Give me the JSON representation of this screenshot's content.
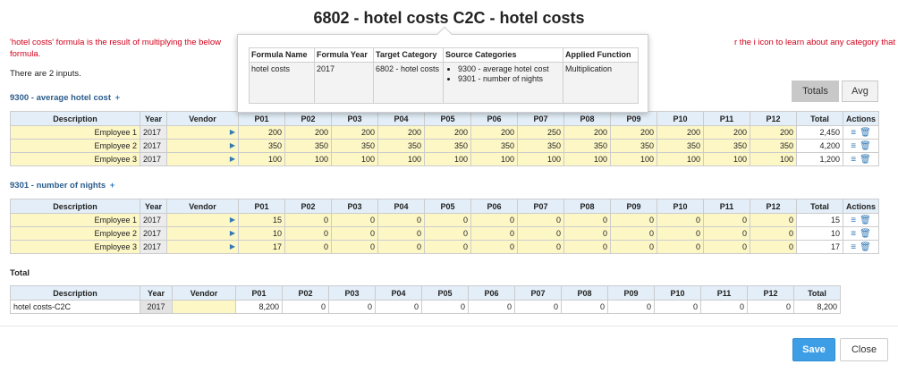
{
  "header": {
    "title": "6802 - hotel costs C2C - hotel costs"
  },
  "notice": {
    "text_left": "'hotel costs' formula is the result of multiplying the below",
    "text_line2": "formula.",
    "text_right": "r the i icon to learn about any category that is also a"
  },
  "inputs_count": "There are 2 inputs.",
  "view_toggle": {
    "totals_label": "Totals",
    "avg_label": "Avg"
  },
  "columns": [
    "Description",
    "Year",
    "Vendor",
    "P01",
    "P02",
    "P03",
    "P04",
    "P05",
    "P06",
    "P07",
    "P08",
    "P09",
    "P10",
    "P11",
    "P12",
    "Total",
    "Actions"
  ],
  "sections": [
    {
      "label": "9300 - average hotel cost",
      "plus": "+",
      "rows": [
        {
          "description": "Employee 1",
          "year": "2017",
          "periods": [
            "200",
            "200",
            "200",
            "200",
            "200",
            "200",
            "250",
            "200",
            "200",
            "200",
            "200",
            "200"
          ],
          "total": "2,450"
        },
        {
          "description": "Employee 2",
          "year": "2017",
          "periods": [
            "350",
            "350",
            "350",
            "350",
            "350",
            "350",
            "350",
            "350",
            "350",
            "350",
            "350",
            "350"
          ],
          "total": "4,200"
        },
        {
          "description": "Employee 3",
          "year": "2017",
          "periods": [
            "100",
            "100",
            "100",
            "100",
            "100",
            "100",
            "100",
            "100",
            "100",
            "100",
            "100",
            "100"
          ],
          "total": "1,200"
        }
      ]
    },
    {
      "label": "9301 - number of nights",
      "plus": "+",
      "rows": [
        {
          "description": "Employee 1",
          "year": "2017",
          "periods": [
            "15",
            "0",
            "0",
            "0",
            "0",
            "0",
            "0",
            "0",
            "0",
            "0",
            "0",
            "0"
          ],
          "total": "15"
        },
        {
          "description": "Employee 2",
          "year": "2017",
          "periods": [
            "10",
            "0",
            "0",
            "0",
            "0",
            "0",
            "0",
            "0",
            "0",
            "0",
            "0",
            "0"
          ],
          "total": "10"
        },
        {
          "description": "Employee 3",
          "year": "2017",
          "periods": [
            "17",
            "0",
            "0",
            "0",
            "0",
            "0",
            "0",
            "0",
            "0",
            "0",
            "0",
            "0"
          ],
          "total": "17"
        }
      ]
    }
  ],
  "total_section": {
    "label": "Total",
    "columns": [
      "Description",
      "Year",
      "Vendor",
      "P01",
      "P02",
      "P03",
      "P04",
      "P05",
      "P06",
      "P07",
      "P08",
      "P09",
      "P10",
      "P11",
      "P12",
      "Total"
    ],
    "row": {
      "description": "hotel costs-C2C",
      "year": "2017",
      "periods": [
        "8,200",
        "0",
        "0",
        "0",
        "0",
        "0",
        "0",
        "0",
        "0",
        "0",
        "0",
        "0"
      ],
      "total": "8,200"
    }
  },
  "popover": {
    "columns": [
      "Formula Name",
      "Formula Year",
      "Target Category",
      "Source Categories",
      "Applied Function"
    ],
    "row": {
      "formula_name": "hotel costs",
      "formula_year": "2017",
      "target_category": "6802 - hotel costs",
      "source_categories": [
        "9300 - average hotel cost",
        "9301 - number of nights"
      ],
      "applied_function": "Multiplication"
    }
  },
  "icons": {
    "edit": "menu-lines-icon",
    "delete": "trash-icon",
    "vendor_dropdown": "caret-right-icon"
  },
  "footer": {
    "save_label": "Save",
    "close_label": "Close"
  },
  "colors": {
    "accent": "#3d9ee6",
    "notice": "#d0021b",
    "input_bg": "#fdf7c6",
    "header_bg": "#e3eef8"
  }
}
